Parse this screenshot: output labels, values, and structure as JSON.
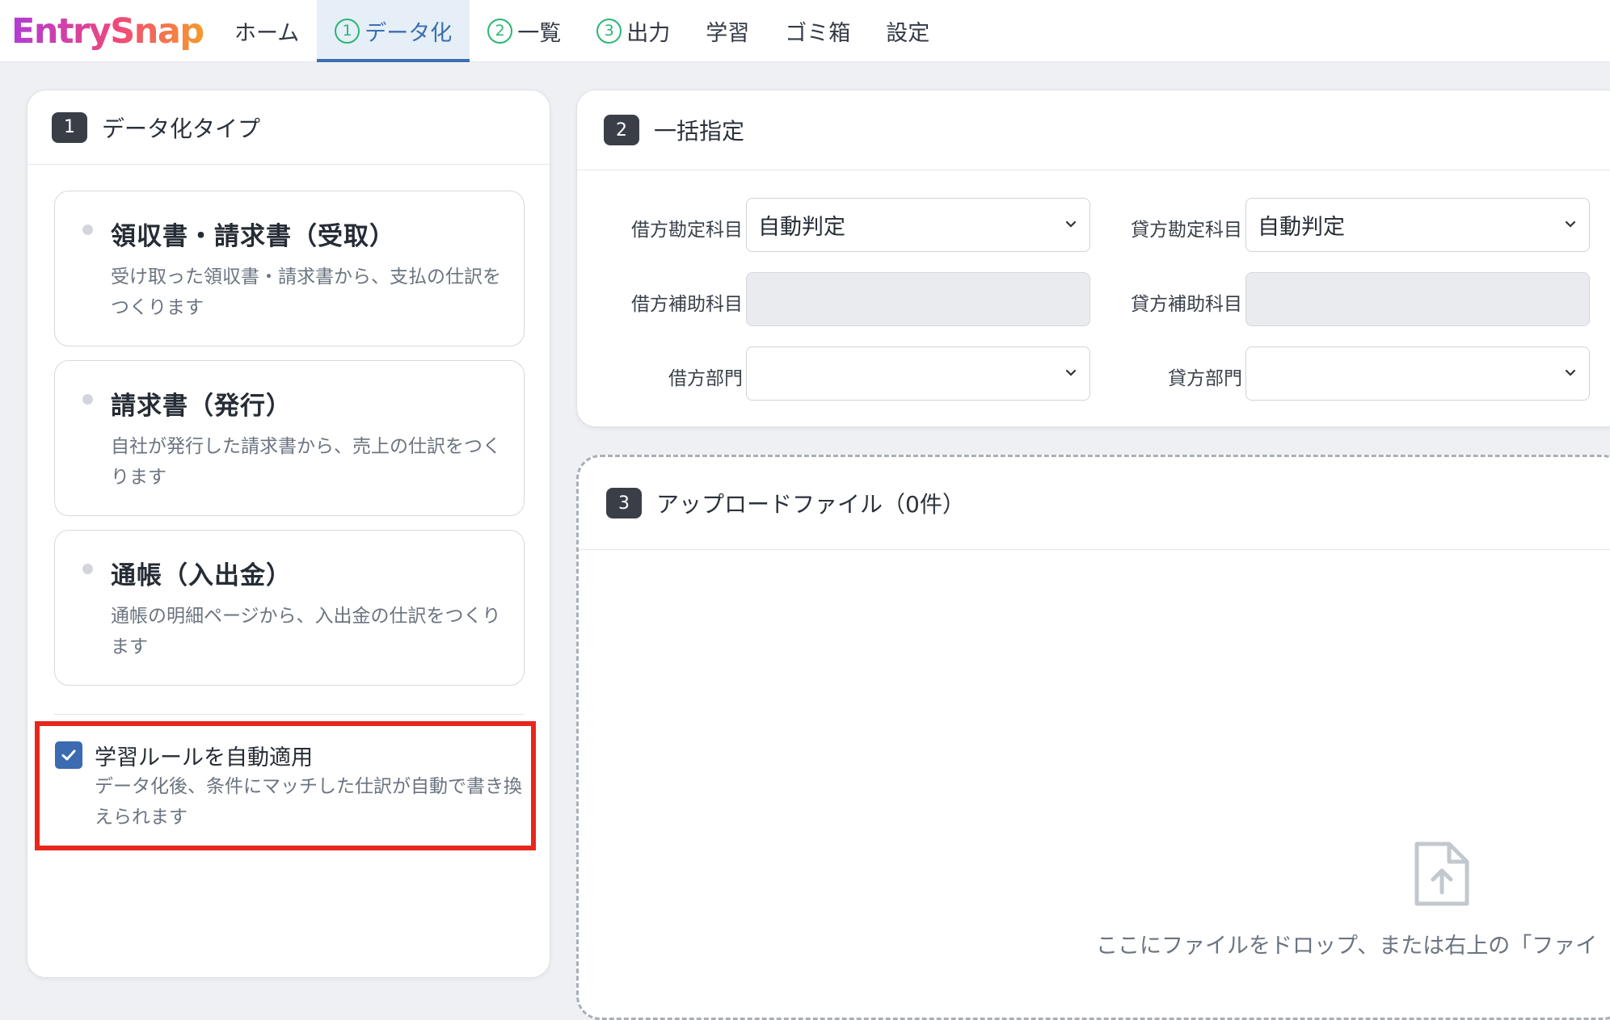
{
  "app": {
    "logo_text": "EntrySnap"
  },
  "nav": {
    "items": [
      {
        "label": "ホーム"
      },
      {
        "num": "1",
        "label": "データ化"
      },
      {
        "num": "2",
        "label": "一覧"
      },
      {
        "num": "3",
        "label": "出力"
      },
      {
        "label": "学習"
      },
      {
        "label": "ゴミ箱"
      },
      {
        "label": "設定"
      }
    ],
    "active": "データ化"
  },
  "type_panel": {
    "badge": "1",
    "title": "データ化タイプ",
    "options": [
      {
        "title": "領収書・請求書（受取）",
        "desc": "受け取った領収書・請求書から、支払の仕訳をつくります"
      },
      {
        "title": "請求書（発行）",
        "desc": "自社が発行した請求書から、売上の仕訳をつくります"
      },
      {
        "title": "通帳（入出金）",
        "desc": "通帳の明細ページから、入出金の仕訳をつくります"
      }
    ],
    "auto_rule": {
      "checked": true,
      "title": "学習ルールを自動適用",
      "desc": "データ化後、条件にマッチした仕訳が自動で書き換えられます"
    }
  },
  "bulk_panel": {
    "badge": "2",
    "title": "一括指定",
    "debit_account_label": "借方勘定科目",
    "debit_account_value": "自動判定",
    "credit_account_label": "貸方勘定科目",
    "credit_account_value": "自動判定",
    "debit_sub_label": "借方補助科目",
    "debit_sub_value": "",
    "credit_sub_label": "貸方補助科目",
    "credit_sub_value": "",
    "debit_dept_label": "借方部門",
    "debit_dept_value": "",
    "credit_dept_label": "貸方部門",
    "credit_dept_value": ""
  },
  "upload_panel": {
    "badge": "3",
    "title": "アップロードファイル（0件）",
    "drop_text": "ここにファイルをドロップ、または右上の「ファイ"
  },
  "colors": {
    "accent": "#3b6bb0",
    "step_green": "#2bb673",
    "highlight_red": "#e8261c"
  }
}
